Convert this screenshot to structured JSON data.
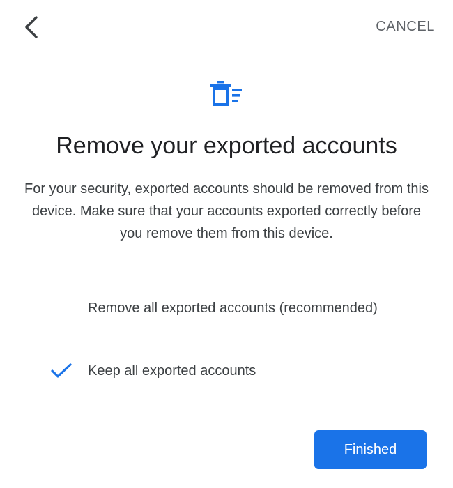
{
  "header": {
    "back_icon": "chevron-left-icon",
    "cancel_label": "CANCEL"
  },
  "hero": {
    "icon": "delete-list-icon",
    "accent_color": "#1a73e8"
  },
  "title": "Remove your exported accounts",
  "description": "For your security, exported accounts should be removed from this device. Make sure that your accounts exported correctly before you remove them from this device.",
  "options": [
    {
      "label": "Remove all exported accounts (recommended)",
      "selected": false
    },
    {
      "label": "Keep all exported accounts",
      "selected": true
    }
  ],
  "footer": {
    "finished_label": "Finished",
    "button_color": "#1a73e8"
  }
}
